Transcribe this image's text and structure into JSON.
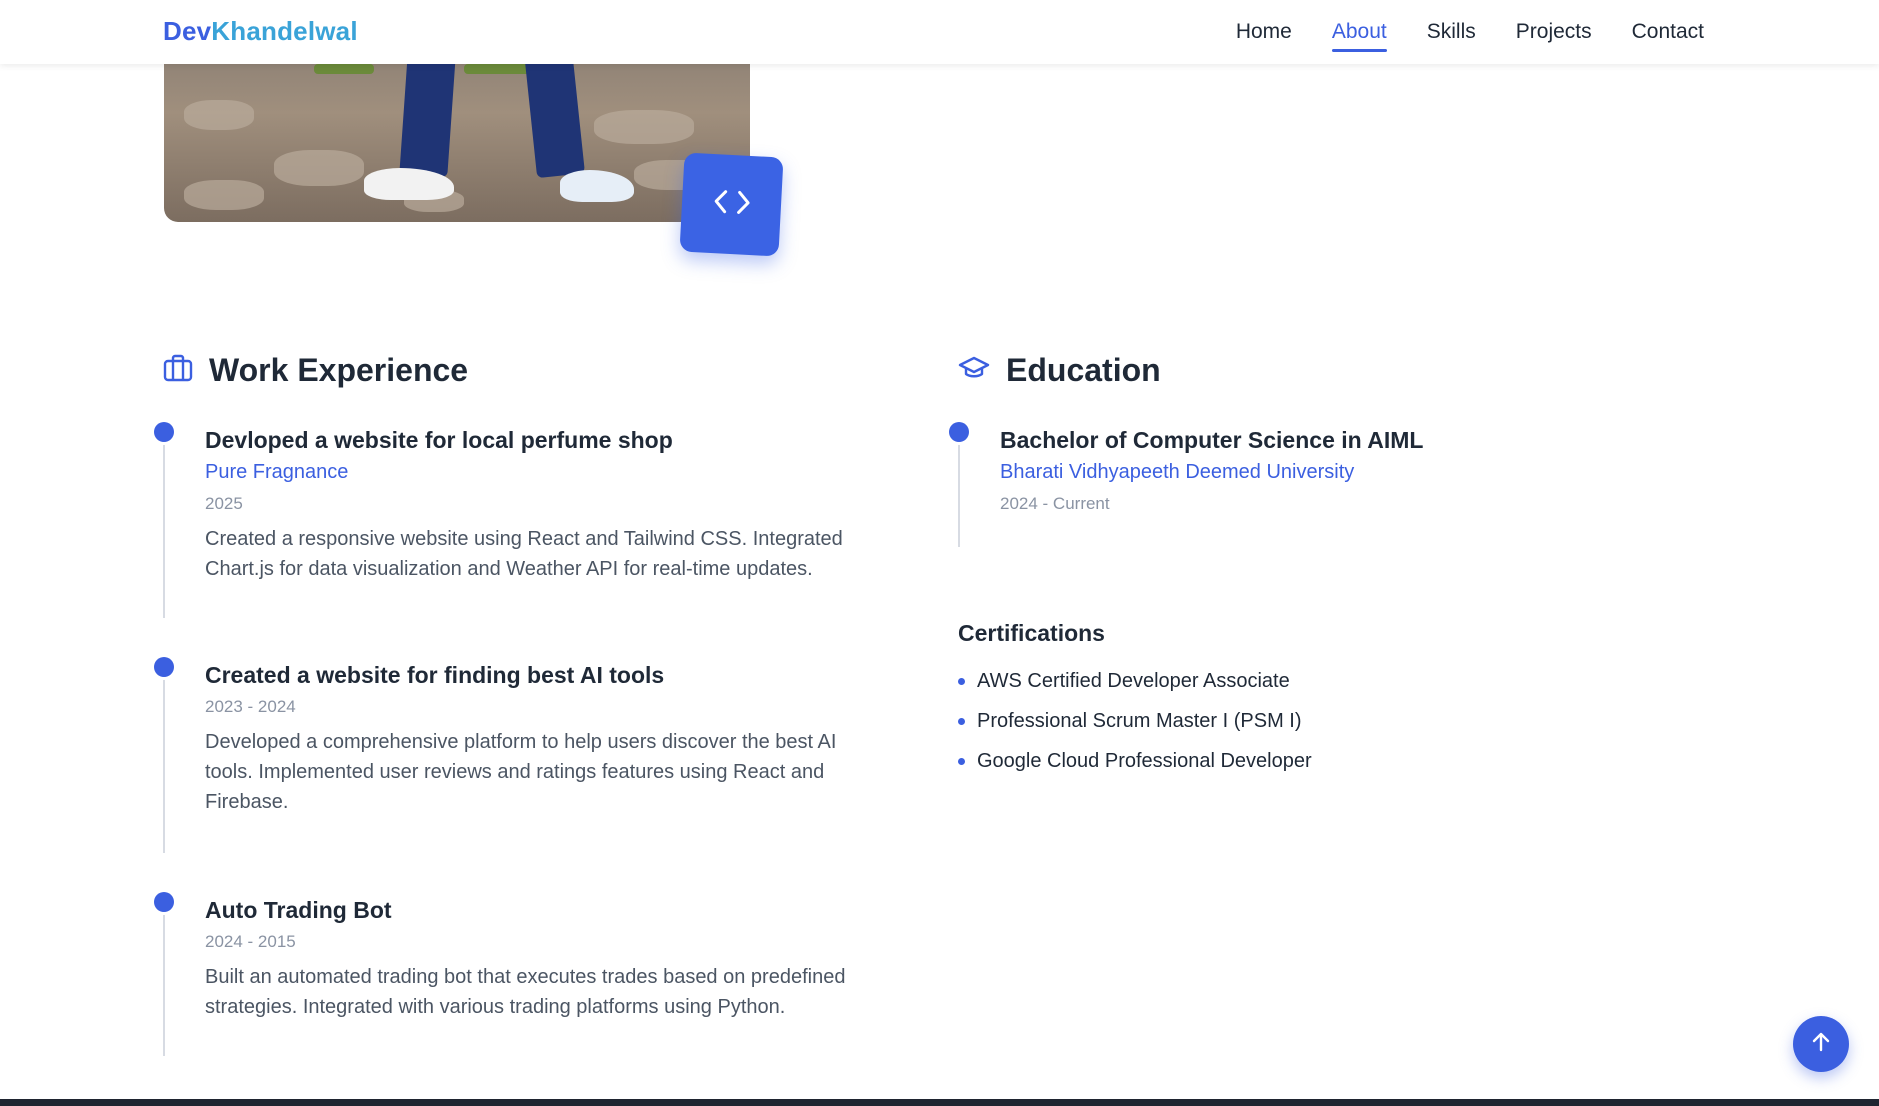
{
  "header": {
    "logo_first": "Dev",
    "logo_last": "Khandelwal",
    "nav": [
      "Home",
      "About",
      "Skills",
      "Projects",
      "Contact"
    ],
    "active": "About"
  },
  "work": {
    "heading": "Work Experience",
    "items": [
      {
        "title": "Devloped a website for local perfume shop",
        "org": "Pure Fragnance",
        "date": "2025",
        "desc_lines": [
          "Created a responsive website using React and Tailwind CSS. Integrated",
          "Chart.js for data visualization and Weather API for real-time updates."
        ]
      },
      {
        "title": "Created a website for finding best AI tools",
        "date": "2023 - 2024",
        "desc_lines": [
          "Developed a comprehensive platform to help users discover the best AI",
          "tools. Implemented user reviews and ratings features using React and",
          "Firebase."
        ]
      },
      {
        "title": "Auto Trading Bot",
        "date": "2024 - 2015",
        "desc_lines": [
          "Built an automated trading bot that executes trades based on predefined",
          "strategies. Integrated with various trading platforms using Python."
        ]
      }
    ]
  },
  "education": {
    "heading": "Education",
    "items": [
      {
        "title": "Bachelor of Computer Science in AIML",
        "org": "Bharati Vidhyapeeth Deemed University",
        "date": "2024 - Current"
      }
    ]
  },
  "certifications": {
    "heading": "Certifications",
    "items": [
      "AWS Certified Developer Associate",
      "Professional Scrum Master I (PSM I)",
      "Google Cloud Professional Developer"
    ]
  },
  "colors": {
    "accent": "#3b5fe0",
    "logo_secondary": "#3aa3d8",
    "text": "#1f2937",
    "muted": "#8a93a3"
  },
  "icons": {
    "work": "briefcase-icon",
    "education": "graduation-cap-icon",
    "badge": "code-icon",
    "scroll_top": "arrow-up-icon"
  }
}
